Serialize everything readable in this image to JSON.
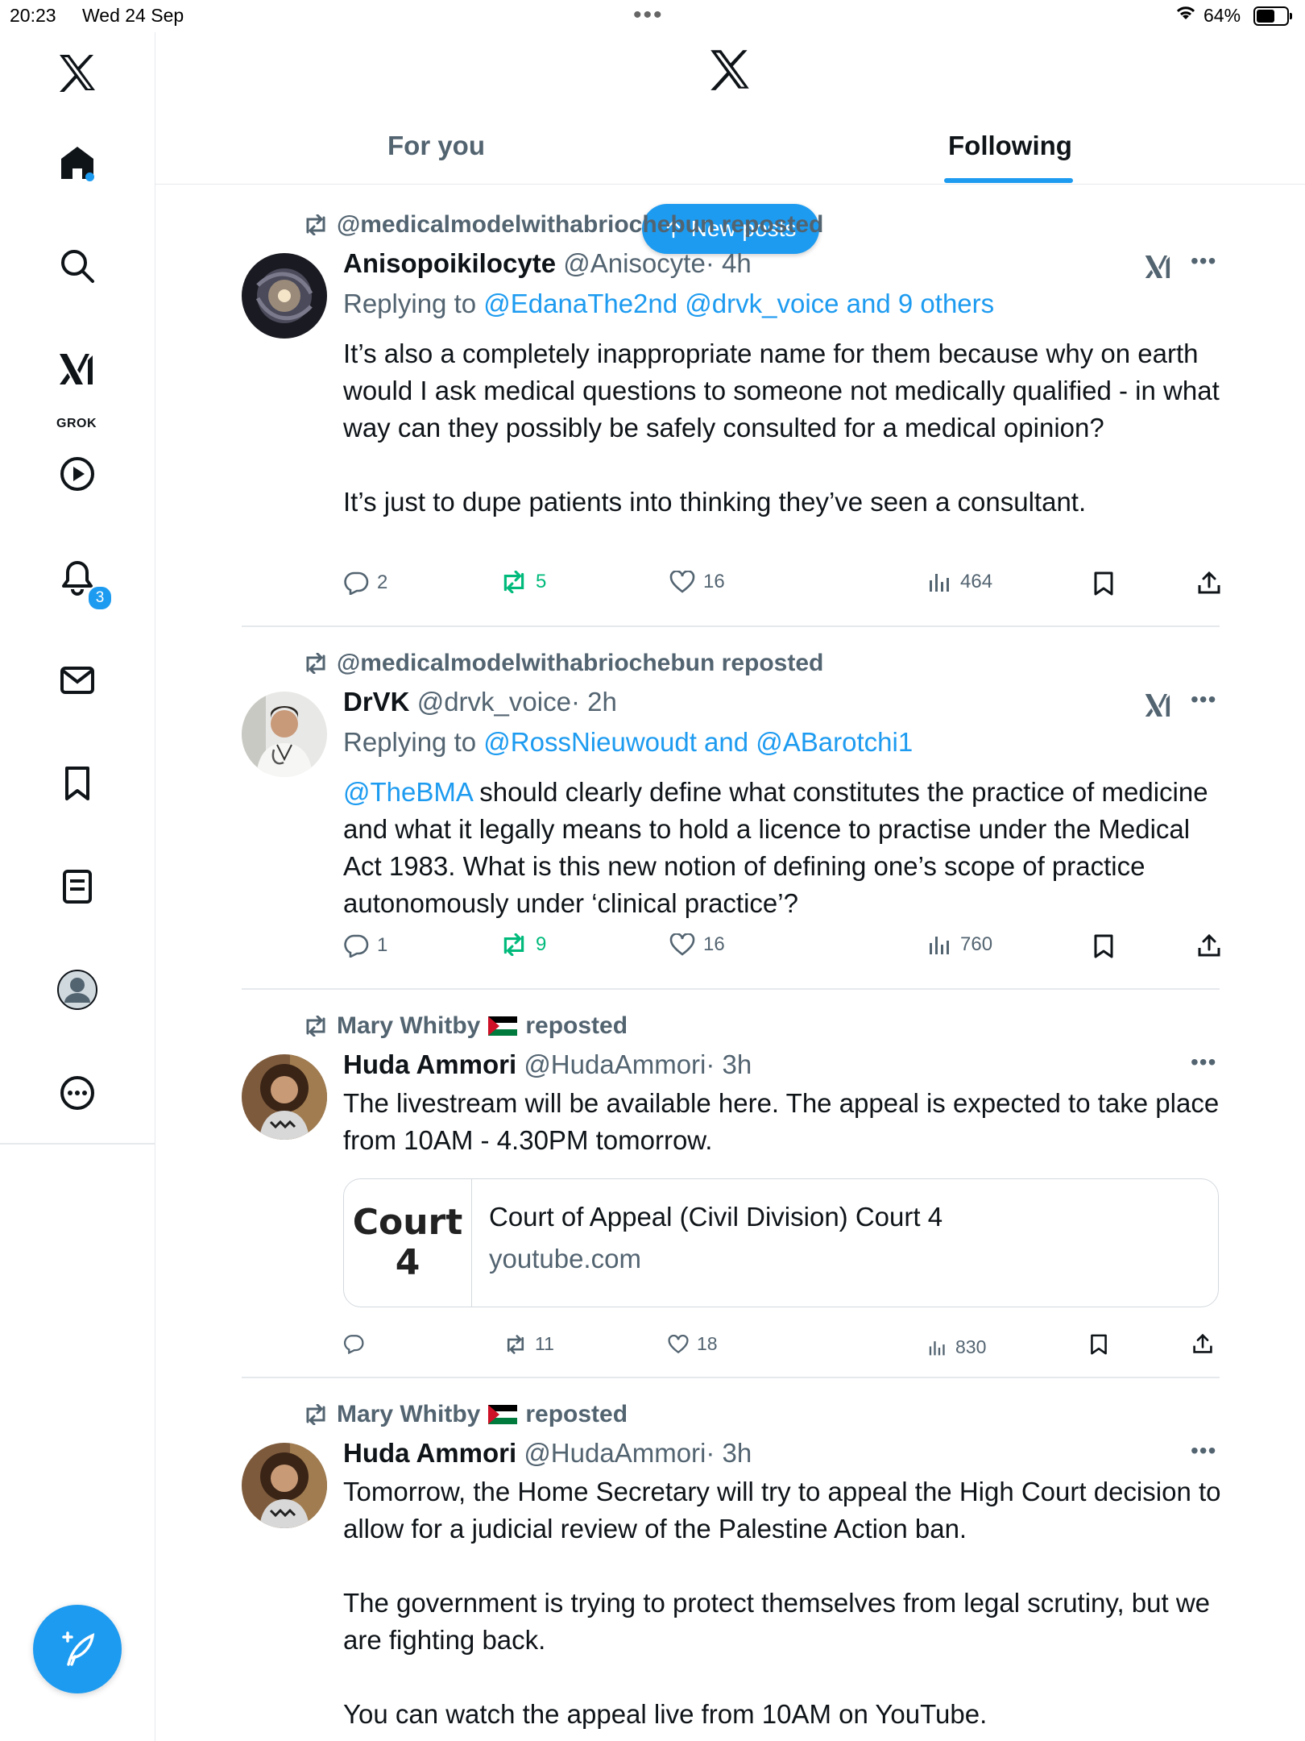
{
  "status_bar": {
    "time": "20:23",
    "date": "Wed 24 Sep",
    "battery": "64%"
  },
  "sidebar": {
    "notification_count": "3",
    "grok_label": "GROK"
  },
  "header": {
    "tabs": [
      {
        "label": "For you"
      },
      {
        "label": "Following"
      }
    ]
  },
  "new_posts": {
    "label": "New posts"
  },
  "posts": [
    {
      "reposted_by": "@medicalmodelwithabriochebun reposted",
      "name": "Anisopoikilocyte",
      "handle": "@Anisocyte",
      "time": "· 4h",
      "replying_prefix": "Replying to ",
      "replying_to": "@EdanaThe2nd @drvk_voice and 9 others",
      "text": "It’s also a completely inappropriate name for them because why on earth would I ask medical questions to someone not medically qualified - in what way can they possibly be safely consulted for a medical opinion?\n\nIt’s just to dupe patients into thinking they’ve seen a consultant.",
      "replies": "2",
      "reposts": "5",
      "likes": "16",
      "views": "464"
    },
    {
      "reposted_by": "@medicalmodelwithabriochebun reposted",
      "name": "DrVK",
      "handle": "@drvk_voice",
      "time": "· 2h",
      "replying_prefix": "Replying to ",
      "replying_to": "@RossNieuwoudt and @ABarotchi1",
      "mention": "@TheBMA",
      "text": " should clearly define what constitutes the practice of medicine and what it legally means to hold a licence to practise under the Medical Act 1983. What is this new notion of defining one’s scope of practice autonomously under ‘clinical practice’?",
      "replies": "1",
      "reposts": "9",
      "likes": "16",
      "views": "760"
    },
    {
      "reposted_by": "Mary Whitby",
      "reposted_suffix": "reposted",
      "name": "Huda Ammori",
      "handle": "@HudaAmmori",
      "time": "· 3h",
      "text": "The livestream will be available here. The appeal is expected to take place from 10AM - 4.30PM tomorrow.",
      "card": {
        "thumb_line1": "Court",
        "thumb_line2": "4",
        "title": "Court of Appeal (Civil Division) Court 4",
        "domain": "youtube.com"
      },
      "replies": "",
      "reposts": "11",
      "likes": "18",
      "views": "830"
    },
    {
      "reposted_by": "Mary Whitby",
      "reposted_suffix": "reposted",
      "name": "Huda Ammori",
      "handle": "@HudaAmmori",
      "time": "· 3h",
      "text": "Tomorrow, the Home Secretary will try to appeal the High Court decision to allow for a judicial review of the Palestine Action ban.\n\nThe government is trying to protect themselves from legal scrutiny, but we are fighting back.\n\nYou can watch the appeal live from 10AM on YouTube."
    }
  ]
}
